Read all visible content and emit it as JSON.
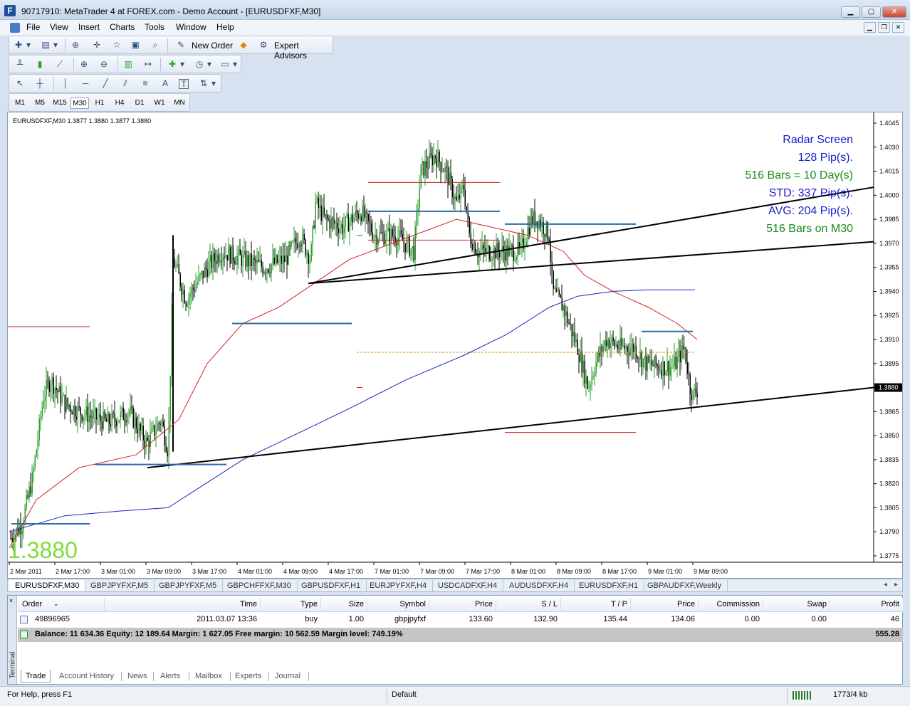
{
  "window": {
    "title": "90717910: MetaTrader 4 at FOREX.com - Demo Account - [EURUSDFXF,M30]",
    "app_icon": "F"
  },
  "menu": {
    "items": [
      "File",
      "View",
      "Insert",
      "Charts",
      "Tools",
      "Window",
      "Help"
    ]
  },
  "toolbar1": {
    "new_order": "New Order",
    "expert_advisors": "Expert Advisors"
  },
  "drawtools": {
    "text_tool": "A",
    "label_tool": "T"
  },
  "timeframes": [
    "M1",
    "M5",
    "M15",
    "M30",
    "H1",
    "H4",
    "D1",
    "W1",
    "MN"
  ],
  "timeframe_active": "M30",
  "chart": {
    "header": "EURUSDFXF,M30  1.3877 1.3880 1.3877 1.3880",
    "big_price": "1.3880",
    "radar": [
      {
        "text": "Radar Screen",
        "color": "#1a1acc"
      },
      {
        "text": "128 Pip(s).",
        "color": "#1a1acc"
      },
      {
        "text": "516 Bars = 10 Day(s)",
        "color": "#1a8a1a"
      },
      {
        "text": "STD: 337 Pip(s).",
        "color": "#1a1acc"
      },
      {
        "text": "AVG: 204 Pip(s).",
        "color": "#1a1acc"
      },
      {
        "text": "516 Bars on M30",
        "color": "#1a8a1a"
      }
    ],
    "price_labels": [
      "1.4045",
      "1.4030",
      "1.4015",
      "1.4000",
      "1.3985",
      "1.3970",
      "1.3955",
      "1.3940",
      "1.3925",
      "1.3910",
      "1.3895",
      "1.3880",
      "1.3865",
      "1.3850",
      "1.3835",
      "1.3820",
      "1.3805",
      "1.3790",
      "1.3775"
    ],
    "current_price": "1.3880",
    "time_labels": [
      "2 Mar 2011",
      "2 Mar 17:00",
      "3 Mar 01:00",
      "3 Mar 09:00",
      "3 Mar 17:00",
      "4 Mar 01:00",
      "4 Mar 09:00",
      "4 Mar 17:00",
      "7 Mar 01:00",
      "7 Mar 09:00",
      "7 Mar 17:00",
      "8 Mar 01:00",
      "8 Mar 09:00",
      "8 Mar 17:00",
      "9 Mar 01:00",
      "9 Mar 09:00"
    ],
    "colors": {
      "bull": "#2aa02a",
      "bear": "#000000",
      "ma_fast": "#d42020",
      "ma_slow": "#2020c0",
      "level_blue": "#2a6aa8",
      "level_red": "#c02020",
      "big_price": "#7fdc3a"
    }
  },
  "chart_tabs": [
    "EURUSDFXF,M30",
    "GBPJPYFXF,M5",
    "GBPJPYFXF,M5",
    "GBPCHFFXF,M30",
    "GBPUSDFXF,H1",
    "EURJPYFXF,H4",
    "USDCADFXF,H4",
    "AUDUSDFXF,H4",
    "EURUSDFXF,H1",
    "GBPAUDFXF,Weekly"
  ],
  "terminal": {
    "side_label": "Terminal",
    "close": "×",
    "columns": {
      "order": "Order",
      "time": "Time",
      "type": "Type",
      "size": "Size",
      "symbol": "Symbol",
      "price": "Price",
      "sl": "S / L",
      "tp": "T / P",
      "price2": "Price",
      "commission": "Commission",
      "swap": "Swap",
      "profit": "Profit"
    },
    "row": {
      "order": "49896965",
      "time": "2011.03.07 13:36",
      "type": "buy",
      "size": "1.00",
      "symbol": "gbpjpyfxf",
      "price": "133.60",
      "sl": "132.90",
      "tp": "135.44",
      "price2": "134.06",
      "commission": "0.00",
      "swap": "0.00",
      "profit": "46"
    },
    "summary": {
      "text": "Balance: 11 634.36  Equity: 12 189.64  Margin: 1 627.05  Free margin: 10 562.59  Margin level: 749.19%",
      "profit": "555.28"
    },
    "tabs": [
      "Trade",
      "Account History",
      "News",
      "Alerts",
      "Mailbox",
      "Experts",
      "Journal"
    ]
  },
  "status": {
    "help": "For Help, press F1",
    "profile": "Default",
    "traffic": "1773/4 kb"
  }
}
